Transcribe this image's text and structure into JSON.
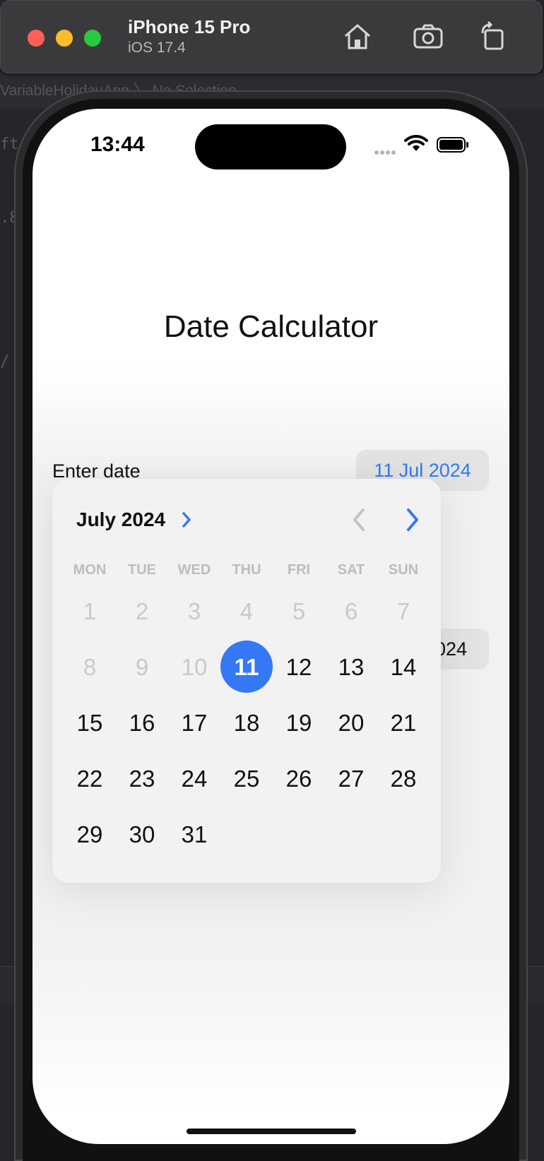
{
  "window": {
    "device_name": "iPhone 15 Pro",
    "os_version": "iOS 17.4",
    "icons": [
      "home-icon",
      "screenshot-icon",
      "rotate-icon"
    ]
  },
  "background": {
    "breadcrumb": "VariableHolidayApp 〉 No Selection",
    "code_fragments": [
      "ft",
      ".8",
      "/"
    ]
  },
  "status_bar": {
    "time": "13:44"
  },
  "app": {
    "title": "Date Calculator",
    "enter_date_label": "Enter date",
    "enter_date_value": "11 Jul 2024",
    "second_date_partial": "024"
  },
  "calendar": {
    "month_label": "July 2024",
    "weekdays": [
      "MON",
      "TUE",
      "WED",
      "THU",
      "FRI",
      "SAT",
      "SUN"
    ],
    "days": [
      {
        "label": "1",
        "state": "muted"
      },
      {
        "label": "2",
        "state": "muted"
      },
      {
        "label": "3",
        "state": "muted"
      },
      {
        "label": "4",
        "state": "muted"
      },
      {
        "label": "5",
        "state": "muted"
      },
      {
        "label": "6",
        "state": "muted"
      },
      {
        "label": "7",
        "state": "muted"
      },
      {
        "label": "8",
        "state": "muted"
      },
      {
        "label": "9",
        "state": "muted"
      },
      {
        "label": "10",
        "state": "muted"
      },
      {
        "label": "11",
        "state": "selected"
      },
      {
        "label": "12",
        "state": "normal"
      },
      {
        "label": "13",
        "state": "normal"
      },
      {
        "label": "14",
        "state": "normal"
      },
      {
        "label": "15",
        "state": "normal"
      },
      {
        "label": "16",
        "state": "normal"
      },
      {
        "label": "17",
        "state": "normal"
      },
      {
        "label": "18",
        "state": "normal"
      },
      {
        "label": "19",
        "state": "normal"
      },
      {
        "label": "20",
        "state": "normal"
      },
      {
        "label": "21",
        "state": "normal"
      },
      {
        "label": "22",
        "state": "normal"
      },
      {
        "label": "23",
        "state": "normal"
      },
      {
        "label": "24",
        "state": "normal"
      },
      {
        "label": "25",
        "state": "normal"
      },
      {
        "label": "26",
        "state": "normal"
      },
      {
        "label": "27",
        "state": "normal"
      },
      {
        "label": "28",
        "state": "normal"
      },
      {
        "label": "29",
        "state": "normal"
      },
      {
        "label": "30",
        "state": "normal"
      },
      {
        "label": "31",
        "state": "normal"
      }
    ],
    "accent_color": "#3478f6"
  }
}
